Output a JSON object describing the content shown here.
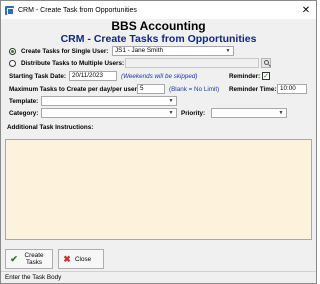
{
  "window": {
    "title": "CRM - Create Task from Opportunities",
    "close_glyph": "✕"
  },
  "header": {
    "company": "BBS Accounting",
    "subtitle": "CRM - Create Tasks from Opportunities"
  },
  "form": {
    "single_user_label": "Create Tasks for Single User:",
    "single_user_value": "JS1 - Jane Smith",
    "multi_user_label": "Distribute Tasks to Multiple Users:",
    "multi_user_value": "",
    "start_date_label": "Starting Task Date:",
    "start_date_value": "20/11/2023",
    "weekend_hint": "(Weekends will be skipped)",
    "reminder_label": "Reminder:",
    "reminder_checked": true,
    "max_tasks_label": "Maximum Tasks to Create per day/per user:",
    "max_tasks_value": "5",
    "max_tasks_hint": "(Blank = No Limit)",
    "reminder_time_label": "Reminder Time:",
    "reminder_time_value": "10:00",
    "template_label": "Template:",
    "template_value": "",
    "category_label": "Category:",
    "category_value": "",
    "priority_label": "Priority:",
    "priority_value": "",
    "instructions_label": "Additional Task Instructions:",
    "instructions_value": ""
  },
  "buttons": {
    "create_label": "Create Tasks",
    "close_label": "Close"
  },
  "status": {
    "text": "Enter the Task Body"
  },
  "colors": {
    "heading_blue": "#10287a",
    "hint_blue": "#1d3a9e",
    "textarea_bg": "#fdf2dc",
    "check_green": "#2d7a1e",
    "close_red": "#d32f2f"
  },
  "icons": {
    "app": "crm-app-icon",
    "search": "search-icon",
    "create": "checkmark-icon",
    "close": "close-x-icon"
  }
}
